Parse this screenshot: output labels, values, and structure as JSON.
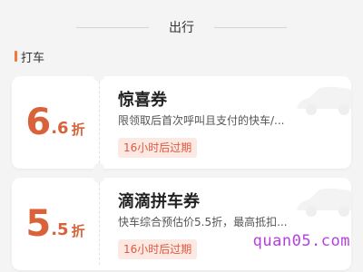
{
  "section": {
    "title": "出行"
  },
  "category": {
    "label": "打车"
  },
  "coupons": [
    {
      "value_int": "6",
      "value_dec": ".6",
      "unit": "折",
      "name": "惊喜券",
      "desc": "限领取后首次呼叫且支付的快车/...",
      "expire": "16小时后过期"
    },
    {
      "value_int": "5",
      "value_dec": ".5",
      "unit": "折",
      "name": "滴滴拼车券",
      "desc": "快车综合预估价5.5折，最高抵扣...",
      "expire": "16小时后过期"
    }
  ],
  "watermark": {
    "text": "quan05.com"
  },
  "colors": {
    "accent": "#d9623a",
    "category_bar": "#f07a3c",
    "expire_bg": "#fde9e4",
    "watermark": "#b53fe0"
  },
  "icons": {
    "card_decoration": "car-icon"
  }
}
